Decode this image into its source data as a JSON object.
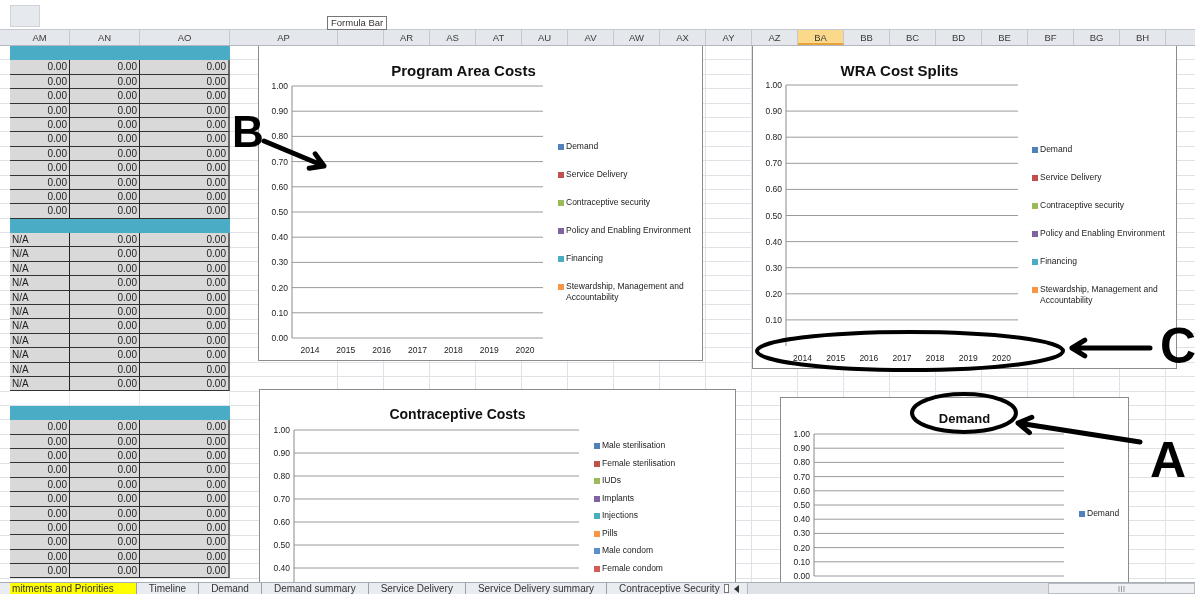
{
  "tooltip": {
    "text": "Formula Bar"
  },
  "columns": [
    {
      "label": "AM",
      "selected": false
    },
    {
      "label": "AN",
      "selected": false
    },
    {
      "label": "AO",
      "selected": false
    },
    {
      "label": "AP",
      "selected": false
    },
    {
      "selected": false
    },
    {
      "label": "AR",
      "selected": false
    },
    {
      "label": "AS",
      "selected": false
    },
    {
      "label": "AT",
      "selected": false
    },
    {
      "label": "AU",
      "selected": false
    },
    {
      "label": "AV",
      "selected": false
    },
    {
      "label": "AW",
      "selected": false
    },
    {
      "label": "AX",
      "selected": false
    },
    {
      "label": "AY",
      "selected": false
    },
    {
      "label": "AZ",
      "selected": false
    },
    {
      "label": "BA",
      "selected": true
    },
    {
      "label": "BB",
      "selected": false
    },
    {
      "label": "BC",
      "selected": false
    },
    {
      "label": "BD",
      "selected": false
    },
    {
      "label": "BE",
      "selected": false
    },
    {
      "label": "BF",
      "selected": false
    },
    {
      "label": "BG",
      "selected": false
    },
    {
      "label": "BH",
      "selected": false
    }
  ],
  "rows": [
    {
      "kind": "band"
    },
    {
      "kind": "numbers",
      "cells": [
        "0.00",
        "0.00",
        "0.00"
      ]
    },
    {
      "kind": "numbers",
      "cells": [
        "0.00",
        "0.00",
        "0.00"
      ]
    },
    {
      "kind": "numbers",
      "cells": [
        "0.00",
        "0.00",
        "0.00"
      ]
    },
    {
      "kind": "numbers",
      "cells": [
        "0.00",
        "0.00",
        "0.00"
      ]
    },
    {
      "kind": "numbers",
      "cells": [
        "0.00",
        "0.00",
        "0.00"
      ]
    },
    {
      "kind": "numbers",
      "cells": [
        "0.00",
        "0.00",
        "0.00"
      ]
    },
    {
      "kind": "numbers",
      "cells": [
        "0.00",
        "0.00",
        "0.00"
      ]
    },
    {
      "kind": "numbers",
      "cells": [
        "0.00",
        "0.00",
        "0.00"
      ]
    },
    {
      "kind": "numbers",
      "cells": [
        "0.00",
        "0.00",
        "0.00"
      ]
    },
    {
      "kind": "numbers",
      "cells": [
        "0.00",
        "0.00",
        "0.00"
      ]
    },
    {
      "kind": "numbers",
      "cells": [
        "0.00",
        "0.00",
        "0.00"
      ]
    },
    {
      "kind": "band"
    },
    {
      "kind": "labelled",
      "cells": [
        "N/A",
        "0.00",
        "0.00"
      ]
    },
    {
      "kind": "labelled",
      "cells": [
        "N/A",
        "0.00",
        "0.00"
      ]
    },
    {
      "kind": "labelled",
      "cells": [
        "N/A",
        "0.00",
        "0.00"
      ]
    },
    {
      "kind": "labelled",
      "cells": [
        "N/A",
        "0.00",
        "0.00"
      ]
    },
    {
      "kind": "labelled",
      "cells": [
        "N/A",
        "0.00",
        "0.00"
      ]
    },
    {
      "kind": "labelled",
      "cells": [
        "N/A",
        "0.00",
        "0.00"
      ]
    },
    {
      "kind": "labelled",
      "cells": [
        "N/A",
        "0.00",
        "0.00"
      ]
    },
    {
      "kind": "labelled",
      "cells": [
        "N/A",
        "0.00",
        "0.00"
      ]
    },
    {
      "kind": "labelled",
      "cells": [
        "N/A",
        "0.00",
        "0.00"
      ]
    },
    {
      "kind": "labelled",
      "cells": [
        "N/A",
        "0.00",
        "0.00"
      ]
    },
    {
      "kind": "labelled",
      "cells": [
        "N/A",
        "0.00",
        "0.00"
      ]
    },
    {
      "kind": "blank"
    },
    {
      "kind": "band"
    },
    {
      "kind": "numbers",
      "cells": [
        "0.00",
        "0.00",
        "0.00"
      ]
    },
    {
      "kind": "numbers",
      "cells": [
        "0.00",
        "0.00",
        "0.00"
      ]
    },
    {
      "kind": "numbers",
      "cells": [
        "0.00",
        "0.00",
        "0.00"
      ]
    },
    {
      "kind": "numbers",
      "cells": [
        "0.00",
        "0.00",
        "0.00"
      ]
    },
    {
      "kind": "numbers",
      "cells": [
        "0.00",
        "0.00",
        "0.00"
      ]
    },
    {
      "kind": "numbers",
      "cells": [
        "0.00",
        "0.00",
        "0.00"
      ]
    },
    {
      "kind": "numbers",
      "cells": [
        "0.00",
        "0.00",
        "0.00"
      ]
    },
    {
      "kind": "numbers",
      "cells": [
        "0.00",
        "0.00",
        "0.00"
      ]
    },
    {
      "kind": "numbers",
      "cells": [
        "0.00",
        "0.00",
        "0.00"
      ]
    },
    {
      "kind": "numbers",
      "cells": [
        "0.00",
        "0.00",
        "0.00"
      ]
    },
    {
      "kind": "numbers",
      "cells": [
        "0.00",
        "0.00",
        "0.00"
      ]
    }
  ],
  "charts": [
    {
      "chart_data": {
        "type": "bar",
        "grid": true,
        "title": "Program Area Costs",
        "categories": [
          "2014",
          "2015",
          "2016",
          "2017",
          "2018",
          "2019",
          "2020"
        ],
        "ylim": [
          0,
          1
        ],
        "yticks": [
          {
            "value": 0,
            "label": "0.00"
          },
          {
            "value": 0.1,
            "label": "0.10"
          },
          {
            "value": 0.2,
            "label": "0.20"
          },
          {
            "value": 0.3,
            "label": "0.30"
          },
          {
            "value": 0.4,
            "label": "0.40"
          },
          {
            "value": 0.5,
            "label": "0.50"
          },
          {
            "value": 0.6,
            "label": "0.60"
          },
          {
            "value": 0.7,
            "label": "0.70"
          },
          {
            "value": 0.8,
            "label": "0.80"
          },
          {
            "value": 0.9,
            "label": "0.90"
          },
          {
            "value": 1,
            "label": "1.00"
          }
        ],
        "series": [
          {
            "name": "Demand",
            "color": "#4f81bd",
            "values": [
              null,
              null,
              null,
              null,
              null,
              null,
              null
            ]
          },
          {
            "name": "Service Delivery",
            "color": "#c0504d",
            "values": [
              null,
              null,
              null,
              null,
              null,
              null,
              null
            ]
          },
          {
            "name": "Contraceptive security",
            "color": "#9bbb59",
            "values": [
              null,
              null,
              null,
              null,
              null,
              null,
              null
            ]
          },
          {
            "name": "Policy and Enabling Environment",
            "color": "#8064a2",
            "values": [
              null,
              null,
              null,
              null,
              null,
              null,
              null
            ]
          },
          {
            "name": "Financing",
            "color": "#4bacc6",
            "values": [
              null,
              null,
              null,
              null,
              null,
              null,
              null
            ]
          },
          {
            "name": "Stewardship, Management and Accountability",
            "color": "#f79646",
            "values": [
              null,
              null,
              null,
              null,
              null,
              null,
              null
            ]
          }
        ]
      }
    },
    {
      "chart_data": {
        "type": "bar",
        "grid": true,
        "title": "WRA Cost Splits",
        "categories": [
          "2014",
          "2015",
          "2016",
          "2017",
          "2018",
          "2019",
          "2020"
        ],
        "ylim": [
          0,
          1
        ],
        "yticks": [
          {
            "value": 0.1,
            "label": "0.10"
          },
          {
            "value": 0.2,
            "label": "0.20"
          },
          {
            "value": 0.3,
            "label": "0.30"
          },
          {
            "value": 0.4,
            "label": "0.40"
          },
          {
            "value": 0.5,
            "label": "0.50"
          },
          {
            "value": 0.6,
            "label": "0.60"
          },
          {
            "value": 0.7,
            "label": "0.70"
          },
          {
            "value": 0.8,
            "label": "0.80"
          },
          {
            "value": 0.9,
            "label": "0.90"
          },
          {
            "value": 1,
            "label": "1.00"
          }
        ],
        "series": [
          {
            "name": "Demand",
            "color": "#4f81bd",
            "values": [
              null,
              null,
              null,
              null,
              null,
              null,
              null
            ]
          },
          {
            "name": "Service Delivery",
            "color": "#c0504d",
            "values": [
              null,
              null,
              null,
              null,
              null,
              null,
              null
            ]
          },
          {
            "name": "Contraceptive security",
            "color": "#9bbb59",
            "values": [
              null,
              null,
              null,
              null,
              null,
              null,
              null
            ]
          },
          {
            "name": "Policy and Enabling Environment",
            "color": "#8064a2",
            "values": [
              null,
              null,
              null,
              null,
              null,
              null,
              null
            ]
          },
          {
            "name": "Financing",
            "color": "#4bacc6",
            "values": [
              null,
              null,
              null,
              null,
              null,
              null,
              null
            ]
          },
          {
            "name": "Stewardship, Management and Accountability",
            "color": "#f79646",
            "values": [
              null,
              null,
              null,
              null,
              null,
              null,
              null
            ]
          }
        ]
      }
    },
    {
      "chart_data": {
        "type": "bar",
        "grid": true,
        "title": "Contraceptive Costs",
        "ylim": [
          0,
          1
        ],
        "yticks": [
          {
            "value": 0.4,
            "label": "0.40"
          },
          {
            "value": 0.5,
            "label": "0.50"
          },
          {
            "value": 0.6,
            "label": "0.60"
          },
          {
            "value": 0.7,
            "label": "0.70"
          },
          {
            "value": 0.8,
            "label": "0.80"
          },
          {
            "value": 0.9,
            "label": "0.90"
          },
          {
            "value": 1,
            "label": "1.00"
          }
        ],
        "series": [
          {
            "name": "Male sterilisation",
            "color": "#4f81bd"
          },
          {
            "name": "Female sterilisation",
            "color": "#c0504d"
          },
          {
            "name": "IUDs",
            "color": "#9bbb59"
          },
          {
            "name": "Implants",
            "color": "#8064a2"
          },
          {
            "name": "Injections",
            "color": "#4bacc6"
          },
          {
            "name": "Pills",
            "color": "#f79646"
          },
          {
            "name": "Male condom",
            "color": "#5b8ed0"
          },
          {
            "name": "Female condom",
            "color": "#d35c5a"
          }
        ]
      }
    },
    {
      "chart_data": {
        "type": "bar",
        "grid": true,
        "title": "Demand",
        "ylim": [
          0,
          1
        ],
        "yticks": [
          {
            "value": 0,
            "label": "0.00"
          },
          {
            "value": 0.1,
            "label": "0.10"
          },
          {
            "value": 0.2,
            "label": "0.20"
          },
          {
            "value": 0.3,
            "label": "0.30"
          },
          {
            "value": 0.4,
            "label": "0.40"
          },
          {
            "value": 0.5,
            "label": "0.50"
          },
          {
            "value": 0.6,
            "label": "0.60"
          },
          {
            "value": 0.7,
            "label": "0.70"
          },
          {
            "value": 0.8,
            "label": "0.80"
          },
          {
            "value": 0.9,
            "label": "0.90"
          },
          {
            "value": 1,
            "label": "1.00"
          }
        ],
        "series": [
          {
            "name": "Demand",
            "color": "#4f81bd"
          }
        ]
      }
    }
  ],
  "sheet_tabs": [
    {
      "label": "mitments and Priorities",
      "selected": true
    },
    {
      "label": "Timeline",
      "selected": false
    },
    {
      "label": "Demand",
      "selected": false
    },
    {
      "label": "Demand summary",
      "selected": false
    },
    {
      "label": "Service Delivery",
      "selected": false
    },
    {
      "label": "Service Delivery summary",
      "selected": false
    },
    {
      "label": "Contraceptive Security",
      "selected": false
    }
  ],
  "annotations": [
    {
      "label": "B"
    },
    {
      "label": "C"
    },
    {
      "label": "A"
    }
  ]
}
